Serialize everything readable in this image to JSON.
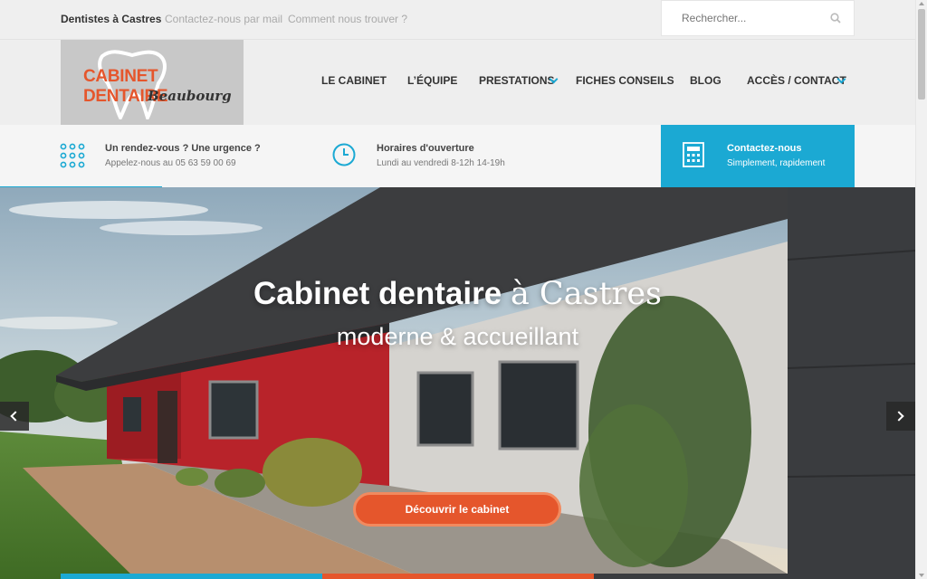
{
  "topbar": {
    "site_title": "Dentistes à Castres",
    "links": [
      "Contactez-nous par mail",
      "Comment nous trouver ?"
    ],
    "search_placeholder": "Rechercher...",
    "search_icon": "search-icon"
  },
  "logo": {
    "line1": "CABINET DENTAIRE",
    "line2": "Beaubourg"
  },
  "nav": [
    {
      "label": "LE CABINET",
      "dropdown": false
    },
    {
      "label": "L’ÉQUIPE",
      "dropdown": false
    },
    {
      "label": "PRESTATIONS",
      "dropdown": true
    },
    {
      "label": "FICHES CONSEILS",
      "dropdown": false
    },
    {
      "label": "BLOG",
      "dropdown": false
    },
    {
      "label": "ACCÈS / CONTACT",
      "dropdown": true
    }
  ],
  "info": [
    {
      "icon": "keypad-icon",
      "title": "Un rendez-vous ? Une urgence ?",
      "sub": "Appelez-nous au 05 63 59 00 69"
    },
    {
      "icon": "clock-icon",
      "title": "Horaires d'ouverture",
      "sub": "Lundi au vendredi 8-12h 14-19h"
    },
    {
      "icon": "calculator-icon",
      "title": "Contactez-nous",
      "sub": "Simplement, rapidement"
    }
  ],
  "hero": {
    "title_bold": "Cabinet dentaire",
    "title_serif": "à Castres",
    "subtitle": "moderne & accueillant",
    "cta": "Découvrir le cabinet",
    "prev_icon": "chevron-left-icon",
    "next_icon": "chevron-right-icon"
  },
  "colors": {
    "accent_blue": "#1ba9d3",
    "accent_orange": "#e5562c",
    "dark": "#333333"
  }
}
